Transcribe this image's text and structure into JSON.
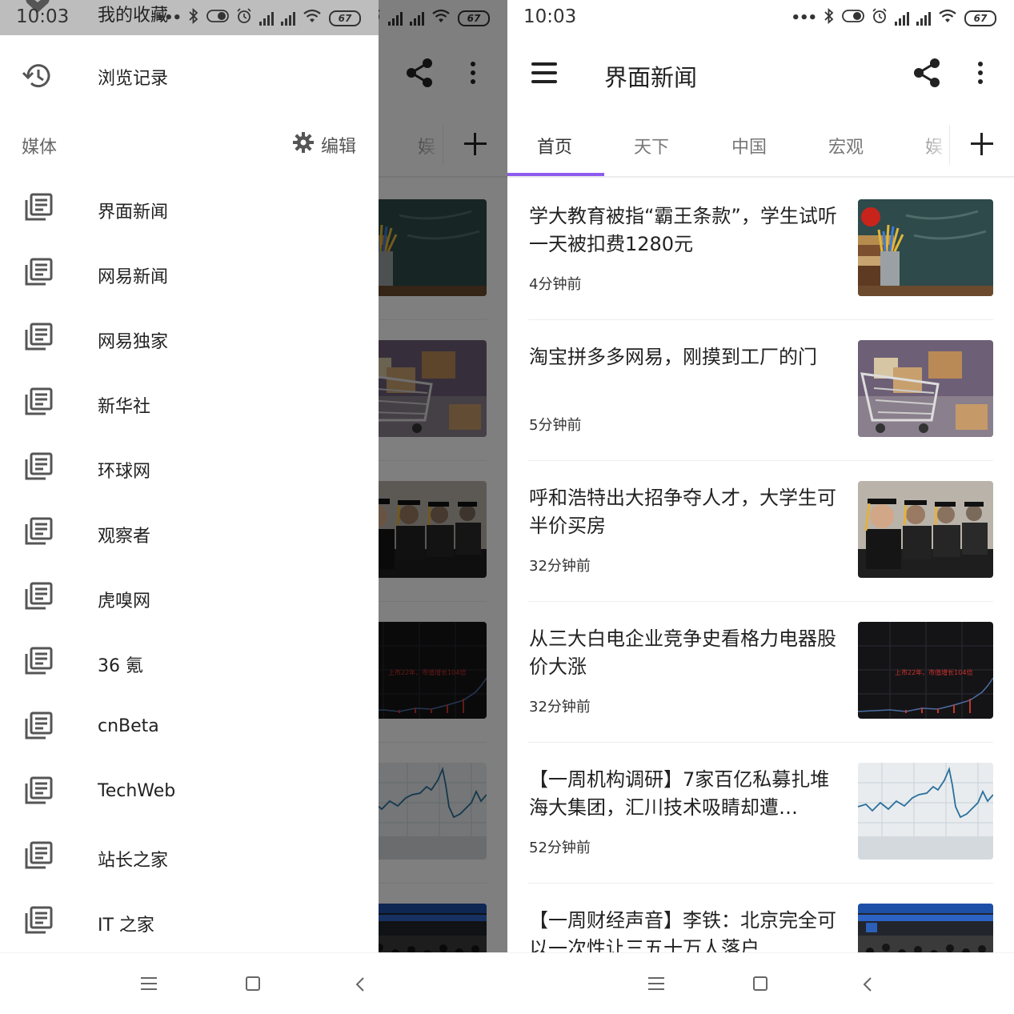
{
  "status": {
    "time": "10:03",
    "battery": "67"
  },
  "app": {
    "title": "界面新闻"
  },
  "tabs": [
    "首页",
    "天下",
    "中国",
    "宏观",
    "娱乐"
  ],
  "tab_fragment": "娱",
  "news": [
    {
      "title": "学大教育被指“霸王条款”，学生试听一天被扣费1280元",
      "time": "4分钟前",
      "thumb": "classroom-desk-image"
    },
    {
      "title": "淘宝拼多多网易，刚摸到工厂的门",
      "time": "5分钟前",
      "thumb": "shopping-cart-boxes-image"
    },
    {
      "title": "呼和浩特出大招争夺人才，大学生可半价买房",
      "time": "32分钟前",
      "thumb": "graduates-image"
    },
    {
      "title": "从三大白电企业竞争史看格力电器股价大涨",
      "time": "32分钟前",
      "thumb": "stock-chart-image",
      "thumb_caption": "上市22年，市值增长104倍"
    },
    {
      "title": "【一周机构调研】7家百亿私募扎堆海大集团，汇川技术吸睛却遭…",
      "time": "52分钟前",
      "thumb": "price-line-chart-image"
    },
    {
      "title": "【一周财经声音】李铁：北京完全可以一次性让三五十万人落户",
      "time": "",
      "thumb": "train-station-crowd-image"
    }
  ],
  "drawer": {
    "top_label": "我的收藏",
    "history_label": "浏览记录",
    "section_title": "媒体",
    "edit_label": "编辑",
    "media": [
      "界面新闻",
      "网易新闻",
      "网易独家",
      "新华社",
      "环球网",
      "观察者",
      "虎嗅网",
      "36 氪",
      "cnBeta",
      "TechWeb",
      "站长之家",
      "IT 之家"
    ]
  },
  "colors": {
    "accent": "#8e5bf0",
    "scrim": "rgba(0,0,0,0.5)",
    "drawer_top": "#bdbdbd"
  },
  "icons": {
    "menu": "hamburger-icon",
    "share": "share-icon",
    "more": "more-vert-icon",
    "add": "plus-icon",
    "history": "history-icon",
    "settings": "gear-icon",
    "media": "library-books-icon",
    "nav": [
      "menu-lines-icon",
      "square-home-icon",
      "back-chevron-icon"
    ]
  }
}
